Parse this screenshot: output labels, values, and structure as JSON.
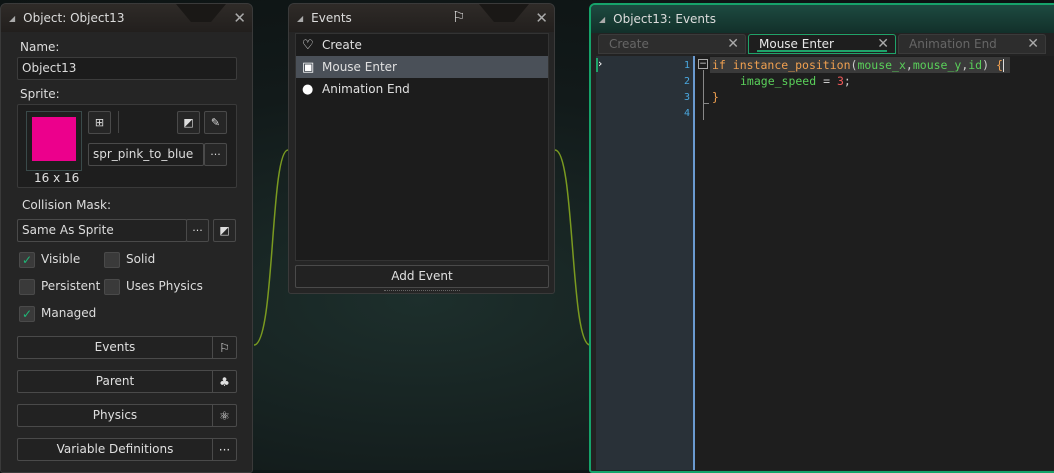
{
  "object_panel": {
    "title": "Object: Object13",
    "name_label": "Name:",
    "name_value": "Object13",
    "sprite_label": "Sprite:",
    "sprite_size": "16 x 16",
    "sprite_name": "spr_pink_to_blue",
    "sprite_color": "#ec008c",
    "ellipsis": "···",
    "collision_label": "Collision Mask:",
    "collision_value": "Same As Sprite",
    "checkboxes": [
      {
        "label": "Visible",
        "checked": true
      },
      {
        "label": "Solid",
        "checked": false
      },
      {
        "label": "Persistent",
        "checked": false
      },
      {
        "label": "Uses Physics",
        "checked": false
      },
      {
        "label": "Managed",
        "checked": true
      }
    ],
    "buttons": [
      {
        "label": "Events",
        "icon": "flag-icon"
      },
      {
        "label": "Parent",
        "icon": "hierarchy-icon"
      },
      {
        "label": "Physics",
        "icon": "atom-icon"
      },
      {
        "label": "Variable Definitions",
        "icon": "ellipsis-icon"
      }
    ]
  },
  "events_panel": {
    "title": "Events",
    "items": [
      {
        "label": "Create",
        "icon": "lightbulb-outline-icon"
      },
      {
        "label": "Mouse Enter",
        "icon": "mouse-icon",
        "selected": true
      },
      {
        "label": "Animation End",
        "icon": "lightbulb-icon"
      }
    ],
    "add_button": "Add Event"
  },
  "editor": {
    "title": "Object13: Events",
    "tabs": [
      {
        "label": "Create"
      },
      {
        "label": "Mouse Enter",
        "active": true
      },
      {
        "label": "Animation End"
      }
    ],
    "line_numbers": [
      "1",
      "2",
      "3",
      "4"
    ],
    "code": {
      "l1_kw": "if",
      "l1_fn": "instance_position",
      "l1_p1": "(",
      "l1_a1": "mouse_x",
      "l1_c1": ",",
      "l1_a2": "mouse_y",
      "l1_c2": ",",
      "l1_a3": "id",
      "l1_p2": ")",
      "l1_br": " {",
      "l2_var": "image_speed",
      "l2_op": " = ",
      "l2_num": "3",
      "l2_sc": ";",
      "l3": "}"
    }
  }
}
